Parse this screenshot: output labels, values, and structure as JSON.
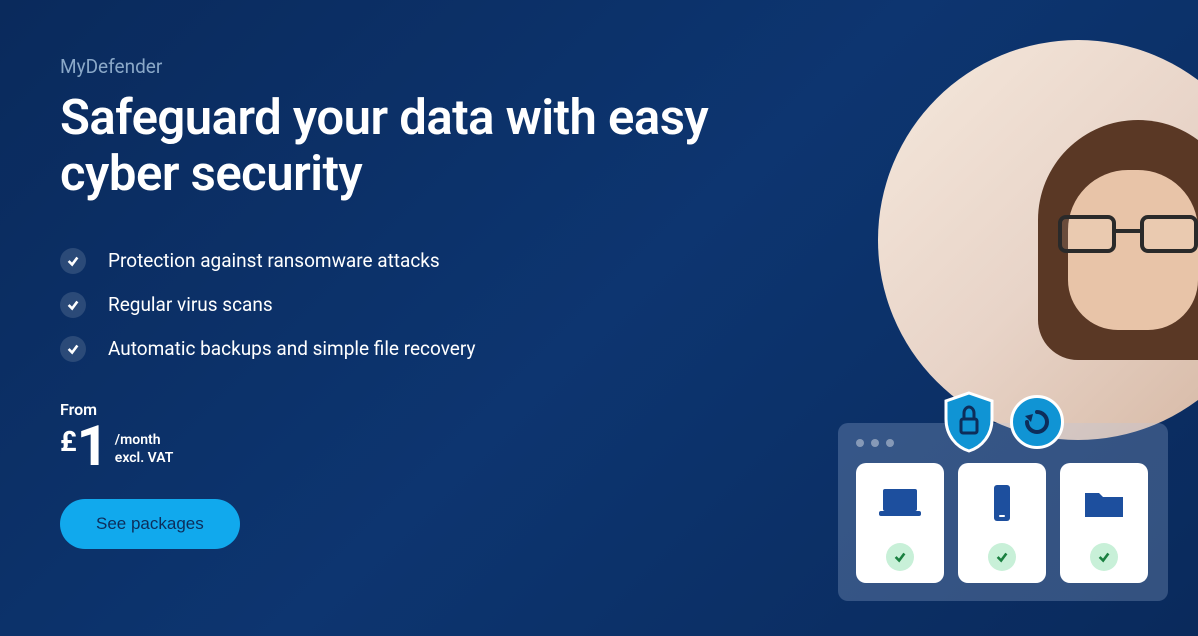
{
  "product_name": "MyDefender",
  "headline": "Safeguard your data with easy cyber security",
  "features": [
    "Protection against ransomware attacks",
    "Regular virus scans",
    "Automatic backups and simple file recovery"
  ],
  "pricing": {
    "from_label": "From",
    "currency": "£",
    "amount": "1",
    "period": "/month",
    "vat_note": "excl. VAT"
  },
  "cta_label": "See packages",
  "icons": {
    "shield": "shield-lock-icon",
    "restore": "restore-icon",
    "card1": "laptop-icon",
    "card2": "phone-icon",
    "card3": "folder-icon"
  }
}
